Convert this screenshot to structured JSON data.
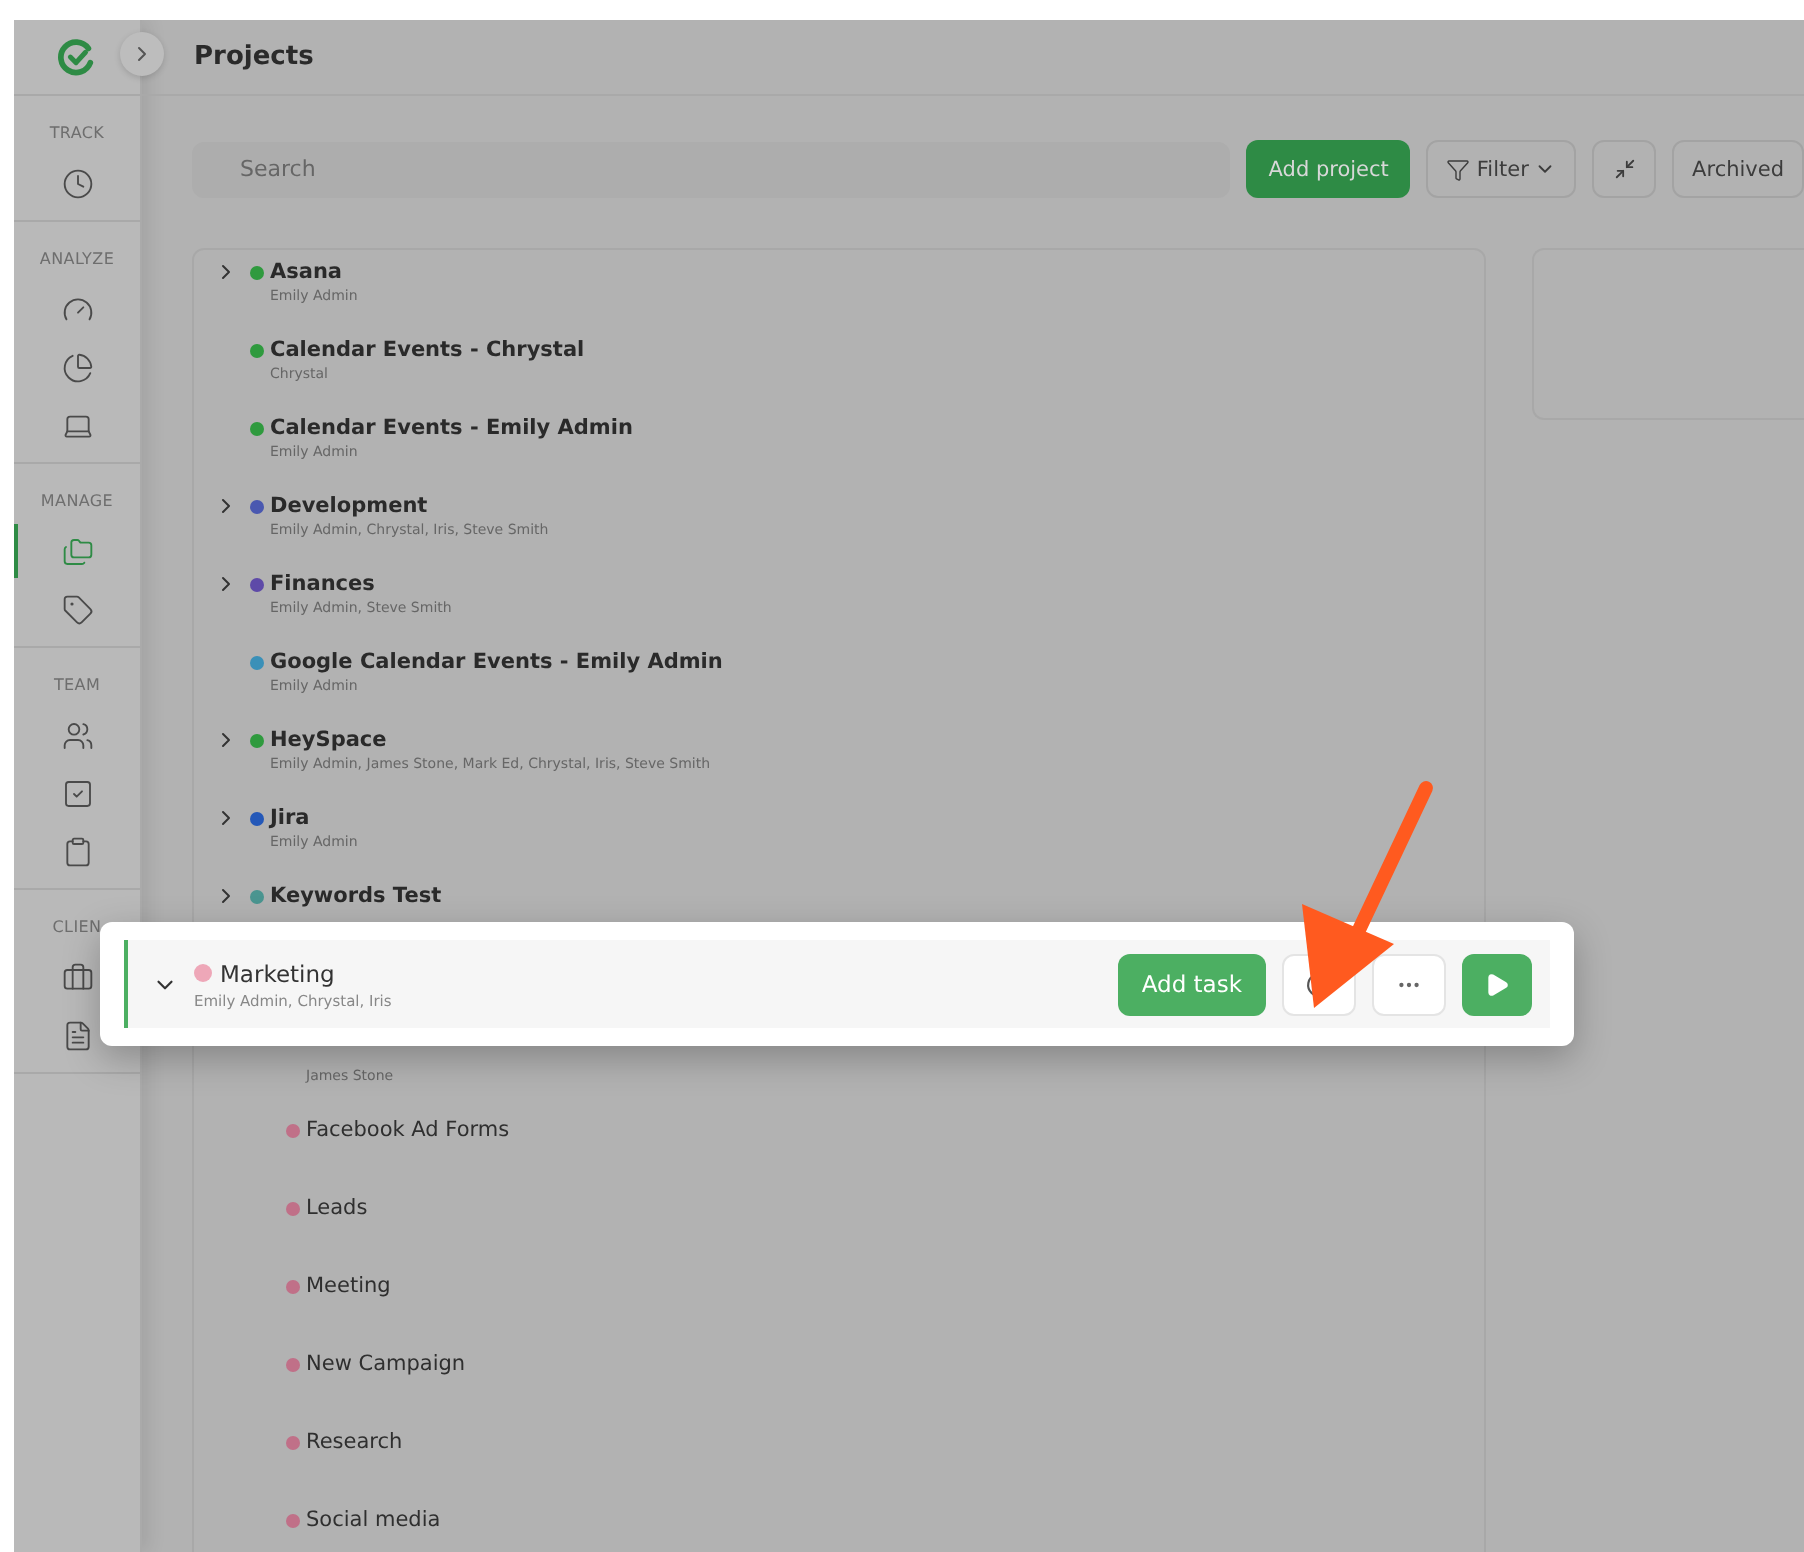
{
  "sidebar": {
    "sections": [
      {
        "label": "TRACK",
        "items": [
          {
            "selected": false
          }
        ]
      },
      {
        "label": "ANALYZE",
        "items": [
          {
            "selected": false
          },
          {
            "selected": false
          },
          {
            "selected": false
          }
        ]
      },
      {
        "label": "MANAGE",
        "items": [
          {
            "selected": true
          },
          {
            "selected": false
          }
        ]
      },
      {
        "label": "TEAM",
        "items": [
          {
            "selected": false
          },
          {
            "selected": false
          },
          {
            "selected": false
          }
        ]
      },
      {
        "label": "CLIEN",
        "items": [
          {
            "selected": false
          },
          {
            "selected": false
          }
        ]
      }
    ]
  },
  "header": {
    "title": "Projects"
  },
  "toolbar": {
    "search": {
      "placeholder": "Search"
    },
    "add_button": "Add project",
    "filter_button": "Filter",
    "archived_button": "Archived"
  },
  "projects": [
    {
      "name": "Asana",
      "members": "Emily Admin",
      "color": "#2f9a3e",
      "expandable": true,
      "expanded": false
    },
    {
      "name": "Calendar Events - Chrystal",
      "members": "Chrystal",
      "color": "#2f9a3e"
    },
    {
      "name": "Calendar Events - Emily Admin",
      "members": "Emily Admin",
      "color": "#2f9a3e"
    },
    {
      "name": "Development",
      "members": "Emily Admin, Chrystal, Iris, Steve Smith",
      "color": "#4a58b0",
      "expandable": true,
      "expanded": false
    },
    {
      "name": "Finances",
      "members": "Emily Admin, Steve Smith",
      "color": "#5e4aa8",
      "expandable": true,
      "expanded": false
    },
    {
      "name": "Google Calendar Events - Emily Admin",
      "members": "Emily Admin",
      "color": "#3a90b8"
    },
    {
      "name": "HeySpace",
      "members": "Emily Admin, James Stone, Mark Ed, Chrystal, Iris, Steve Smith",
      "color": "#2f9a3e",
      "expandable": true,
      "expanded": false
    },
    {
      "name": "Jira",
      "members": "Emily Admin",
      "color": "#2458b8",
      "expandable": true,
      "expanded": false
    },
    {
      "name": "Keywords Test",
      "color": "#4a9590",
      "expandable": true,
      "expanded": false
    },
    {
      "name": "Marketing",
      "members": "Emily Admin, Chrystal, Iris",
      "color": "#eea7b8",
      "expandable": true,
      "expanded": true,
      "highlighted": true,
      "add_task_button": "Add task",
      "children": [
        {
          "members": "James Stone"
        },
        {
          "name": "Facebook Ad Forms",
          "color": "#c07088"
        },
        {
          "name": "Leads",
          "color": "#c07088"
        },
        {
          "name": "Meeting",
          "color": "#c07088"
        },
        {
          "name": "New Campaign",
          "color": "#c07088"
        },
        {
          "name": "Research",
          "color": "#c07088"
        },
        {
          "name": "Social media",
          "color": "#c07088"
        }
      ]
    }
  ]
}
